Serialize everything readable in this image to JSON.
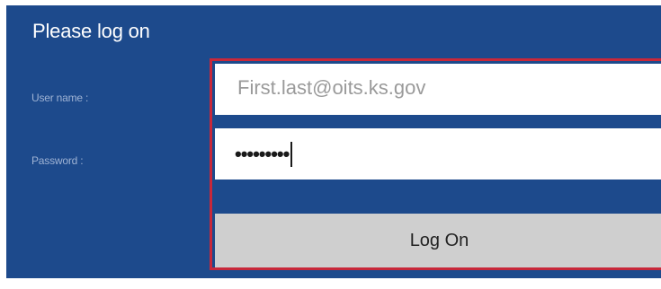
{
  "login": {
    "title": "Please log on",
    "username_label": "User name :",
    "password_label": "Password :",
    "username_value": "First.last@oits.ks.gov",
    "password_masked": "•••••••••",
    "submit_label": "Log On"
  },
  "colors": {
    "panel_background": "#1d4a8c",
    "highlight_border": "#c8283a",
    "button_background": "#cfcfcf"
  }
}
